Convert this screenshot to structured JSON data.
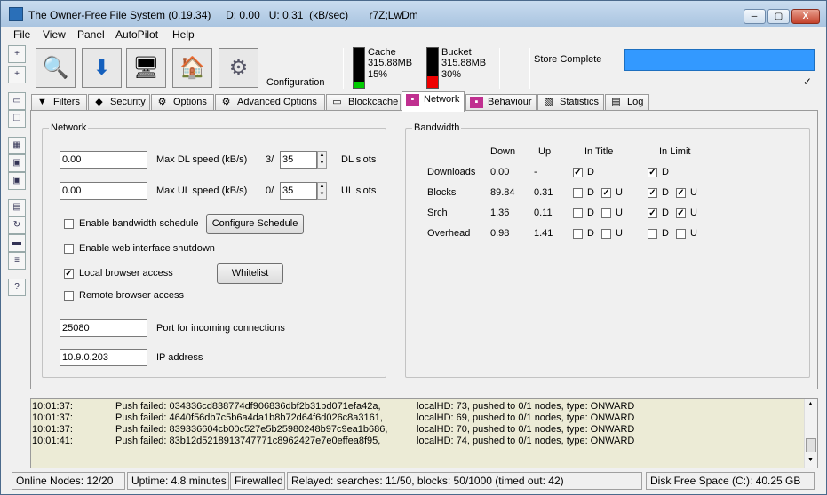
{
  "window": {
    "title": "The Owner-Free File System (0.19.34)     D: 0.00   U: 0.31  (kB/sec)       r7Z;LwDm",
    "min": "–",
    "max": "▢",
    "close": "X"
  },
  "menu": [
    "File",
    "View",
    "Panel",
    "AutoPilot",
    "Help"
  ],
  "toolbar": {
    "icons": [
      "search-icon",
      "download-icon",
      "network-monitor-icon",
      "home-icon",
      "gear-icon"
    ],
    "configuration_label": "Configuration"
  },
  "meters": {
    "cache": {
      "label": "Cache",
      "size": "315.88MB",
      "percent": "15%",
      "fill": 0.15,
      "color": "#00cc00"
    },
    "bucket": {
      "label": "Bucket",
      "size": "315.88MB",
      "percent": "30%",
      "fill": 0.3,
      "color": "#ee0000"
    }
  },
  "store": {
    "label": "Store Complete",
    "accent": "#3399ff",
    "check": "✓"
  },
  "tabs": [
    "Filters",
    "Security",
    "Options",
    "Advanced Options",
    "Blockcache",
    "Network",
    "Behaviour",
    "Statistics",
    "Log"
  ],
  "active_tab": "Network",
  "network": {
    "group_title": "Network",
    "dl_speed": "0.00",
    "dl_label": "Max DL speed (kB/s)",
    "dl_slots_used": "3/",
    "dl_slots": "35",
    "dl_slots_label": "DL slots",
    "ul_speed": "0.00",
    "ul_label": "Max UL speed (kB/s)",
    "ul_slots_used": "0/",
    "ul_slots": "35",
    "ul_slots_label": "UL slots",
    "enable_schedule": "Enable bandwidth schedule",
    "configure_schedule": "Configure Schedule",
    "enable_web_shutdown": "Enable web interface shutdown",
    "local_browser": "Local browser access",
    "whitelist": "Whitelist",
    "remote_browser": "Remote browser access",
    "port": "25080",
    "port_label": "Port for incoming connections",
    "ip": "10.9.0.203",
    "ip_label": "IP address"
  },
  "bandwidth": {
    "group_title": "Bandwidth",
    "headers": {
      "down": "Down",
      "up": "Up",
      "in_title": "In Title",
      "in_limit": "In Limit"
    },
    "rows": [
      {
        "label": "Downloads",
        "down": "0.00",
        "up": "-"
      },
      {
        "label": "Blocks",
        "down": "89.84",
        "up": "0.31"
      },
      {
        "label": "Srch",
        "down": "1.36",
        "up": "0.11"
      },
      {
        "label": "Overhead",
        "down": "0.98",
        "up": "1.41"
      }
    ],
    "d": "D",
    "u": "U"
  },
  "log": [
    {
      "time": "10:01:37:",
      "msg": "Push failed: 034336cd838774df906836dbf2b31bd071efa42a,",
      "info": "localHD: 73, pushed to 0/1 nodes, type: ONWARD"
    },
    {
      "time": "10:01:37:",
      "msg": "Push failed: 4640f56db7c5b6a4da1b8b72d64f6d026c8a3161,",
      "info": "localHD: 69, pushed to 0/1 nodes, type: ONWARD"
    },
    {
      "time": "10:01:37:",
      "msg": "Push failed: 839336604cb00c527e5b25980248b97c9ea1b686,",
      "info": "localHD: 70, pushed to 0/1 nodes, type: ONWARD"
    },
    {
      "time": "10:01:41:",
      "msg": "Push failed: 83b12d5218913747771c8962427e7e0effea8f95,",
      "info": "localHD: 74, pushed to 0/1 nodes, type: ONWARD"
    }
  ],
  "status": {
    "nodes": "Online Nodes: 12/20",
    "uptime": "Uptime: 4.8 minutes",
    "firewall": "Firewalled",
    "relayed": "Relayed:  searches: 11/50,   blocks: 50/1000 (timed out: 42)",
    "disk": "Disk Free Space (C:): 40.25 GB"
  }
}
